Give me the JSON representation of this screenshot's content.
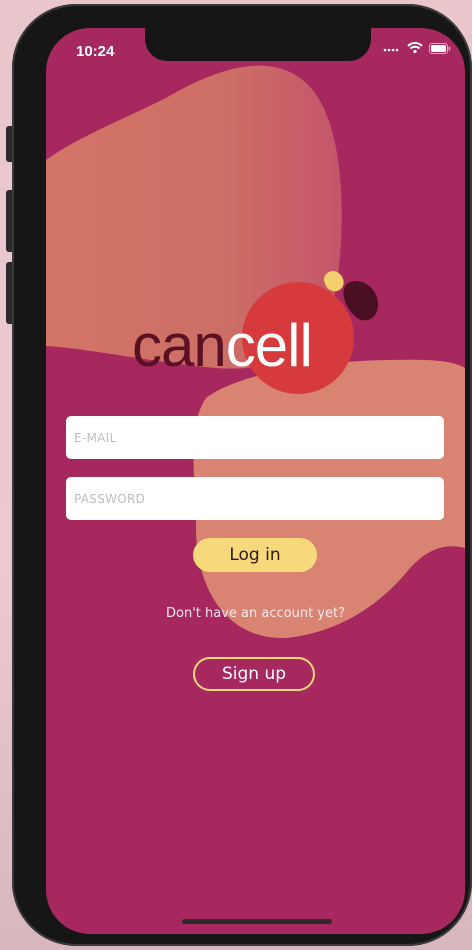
{
  "status_bar": {
    "time": "10:24"
  },
  "logo": {
    "part1": "can",
    "part2": "cell"
  },
  "form": {
    "email_placeholder": "E-MAIL",
    "password_placeholder": "PASSWORD",
    "login_label": "Log in",
    "no_account_text": "Don't have an account yet?",
    "signup_label": "Sign up"
  },
  "colors": {
    "background": "#a6285e",
    "accent_yellow": "#f6d97a",
    "blob_salmon": "#d8816e",
    "blob_red": "#d6393b"
  },
  "icons": [
    "signal-icon",
    "wifi-icon",
    "battery-icon"
  ]
}
